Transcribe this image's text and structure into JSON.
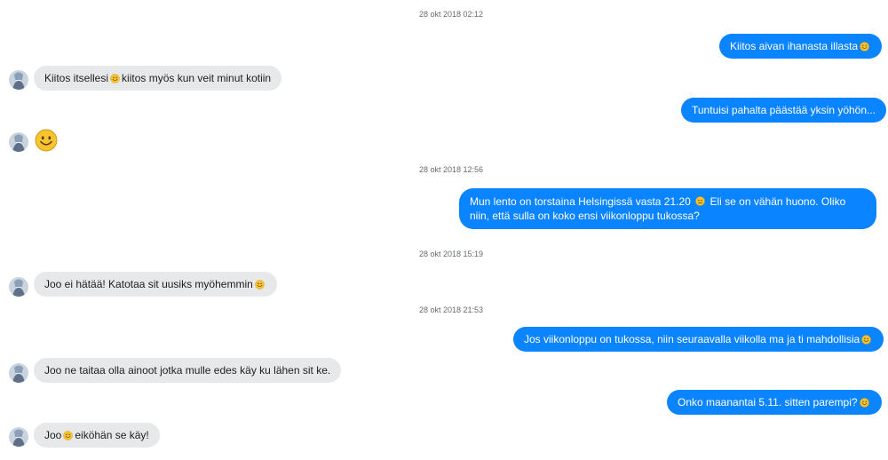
{
  "timestamps": [
    "28 okt 2018 02:12",
    "28 okt 2018  12:56",
    "28 okt 2018  15:19",
    "28 okt 2018  21:53"
  ],
  "messages": [
    {
      "dir": "out",
      "text": "Kiitos aivan ihanasta illasta",
      "emoji_after": true
    },
    {
      "dir": "in",
      "text_before": "Kiitos itsellesi",
      "text_after": "kiitos myös kun veit minut kotiin"
    },
    {
      "dir": "out",
      "text": "Tuntuisi pahalta päästää yksin yöhön..."
    },
    {
      "dir": "in",
      "emoji_only": "smiling-face"
    },
    {
      "dir": "out",
      "text_before": "Mun lento on torstaina Helsingissä vasta 21.20",
      "text_after": "Eli se on vähän huono. Oliko niin, että sulla on koko ensi viikonloppu tukossa?"
    },
    {
      "dir": "in",
      "text": "Joo ei hätää! Katotaa sit uusiks myöhemmin",
      "emoji_after": true
    },
    {
      "dir": "out",
      "text": "Jos viikonloppu on tukossa, niin seuraavalla viikolla ma ja ti mahdollisia",
      "emoji_after": true
    },
    {
      "dir": "in",
      "text": "Joo ne taitaa olla ainoot jotka mulle edes käy ku lähen sit ke."
    },
    {
      "dir": "out",
      "text": "Onko maanantai 5.11. sitten parempi?",
      "emoji_after": true
    },
    {
      "dir": "in",
      "text_before": "Joo",
      "text_after": "eiköhän se käy!"
    }
  ],
  "colors": {
    "outgoing": "#0b84ff",
    "incoming": "#e7e8ea",
    "timestamp": "#666a70",
    "emoji": "#f7c431"
  },
  "icons": {
    "avatar": "contact-avatar",
    "emoji": "smiling-face-emoji"
  }
}
